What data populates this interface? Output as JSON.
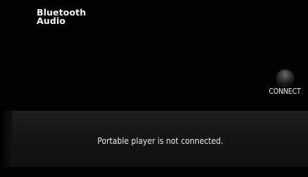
{
  "screen": {
    "title_line1": "Bluetooth",
    "title_line2": "Audio"
  },
  "connect": {
    "label": "CONNECT",
    "icon": "knob-button-icon"
  },
  "status": {
    "message": "Portable player is not connected."
  }
}
